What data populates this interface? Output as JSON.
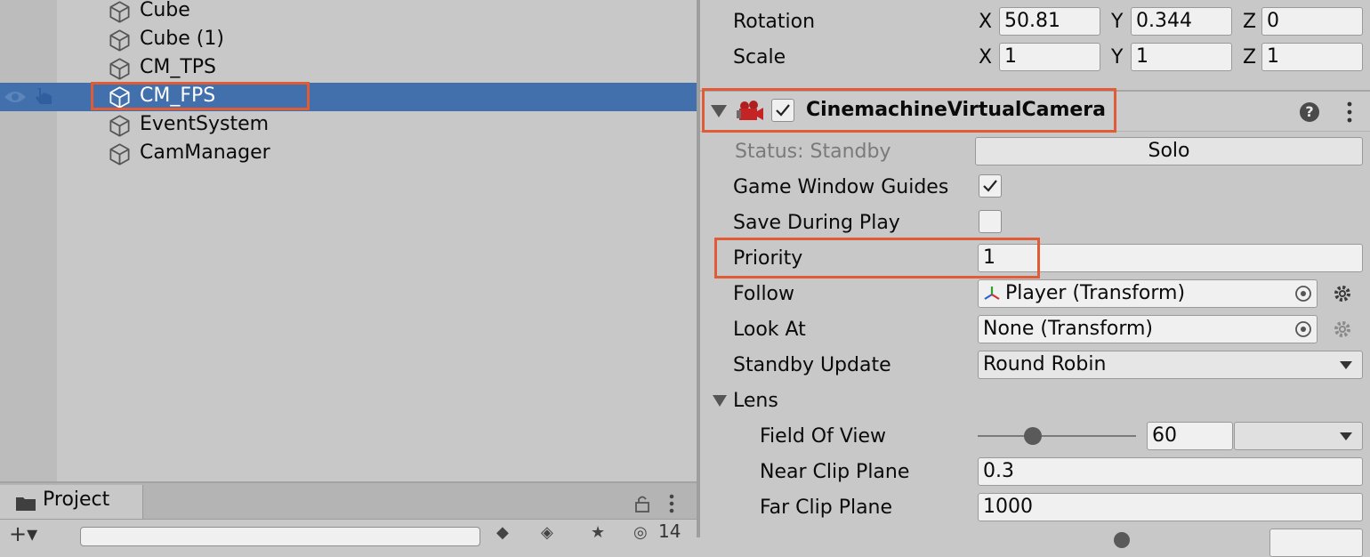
{
  "hierarchy": {
    "items": [
      {
        "label": "Cube"
      },
      {
        "label": "Cube (1)"
      },
      {
        "label": "CM_TPS"
      },
      {
        "label": "CM_FPS",
        "selected": true
      },
      {
        "label": "EventSystem"
      },
      {
        "label": "CamManager"
      }
    ]
  },
  "project": {
    "tab_label": "Project",
    "hidden_count": "14"
  },
  "inspector": {
    "transform": {
      "rotation_label": "Rotation",
      "rotation": {
        "x": "50.81",
        "y": "0.344",
        "z": "0"
      },
      "scale_label": "Scale",
      "scale": {
        "x": "1",
        "y": "1",
        "z": "1"
      },
      "axis_x": "X",
      "axis_y": "Y",
      "axis_z": "Z"
    },
    "component": {
      "title": "CinemachineVirtualCamera",
      "enabled": true,
      "help_glyph": "?",
      "status_label": "Status: Standby",
      "solo_label": "Solo",
      "game_window_guides_label": "Game Window Guides",
      "game_window_guides": true,
      "save_during_play_label": "Save During Play",
      "save_during_play": false,
      "priority_label": "Priority",
      "priority": "1",
      "follow_label": "Follow",
      "follow_value": "Player (Transform)",
      "look_at_label": "Look At",
      "look_at_value": "None (Transform)",
      "standby_update_label": "Standby Update",
      "standby_update_value": "Round Robin",
      "lens": {
        "label": "Lens",
        "fov_label": "Field Of View",
        "fov": "60",
        "near_label": "Near Clip Plane",
        "near": "0.3",
        "far_label": "Far Clip Plane",
        "far": "1000"
      }
    }
  },
  "colors": {
    "selection": "#4170ad",
    "highlight_box": "#e15c36",
    "panel_bg": "#c8c8c8"
  }
}
